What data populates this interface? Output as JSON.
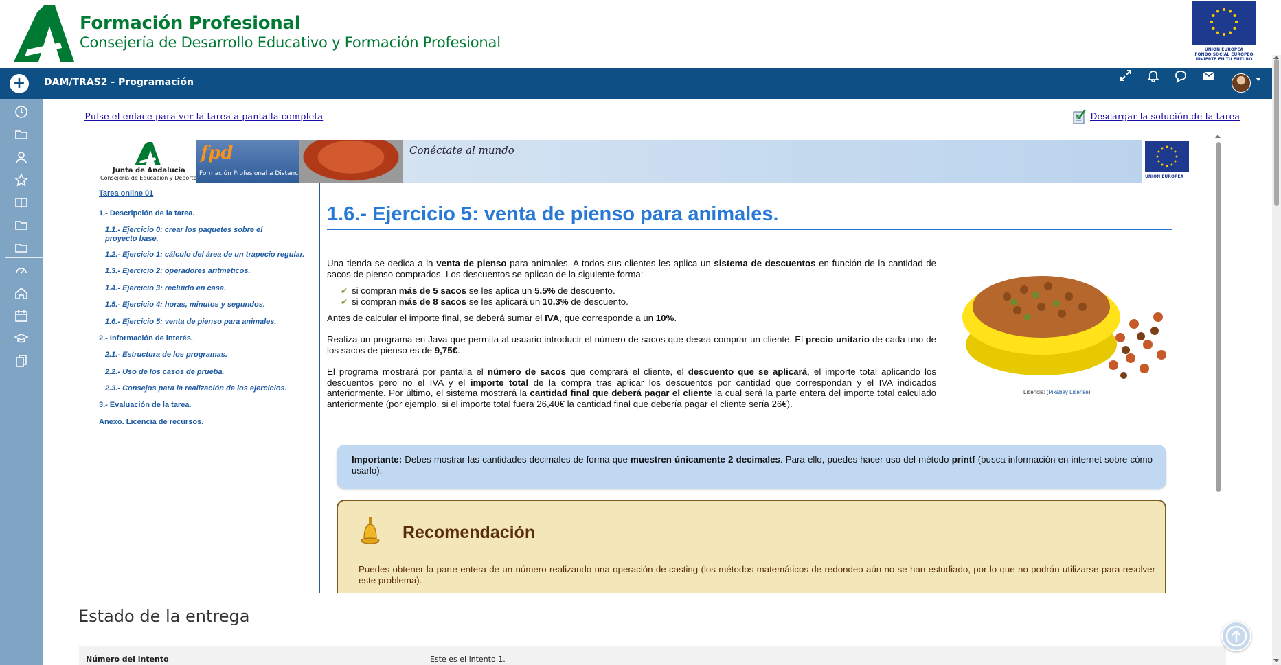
{
  "header": {
    "brand_title": "Formación Profesional",
    "brand_subtitle": "Consejería de Desarrollo Educativo y Formación Profesional",
    "eu_text_1": "UNIÓN EUROPEA",
    "eu_text_2": "FONDO SOCIAL EUROPEO",
    "eu_text_3": "INVIERTE EN TU FUTURO"
  },
  "navbar": {
    "title": "DAM/TRAS2 - Programación",
    "icons": [
      "fullscreen-icon",
      "bell-icon",
      "chat-icon",
      "mail-icon"
    ]
  },
  "sidebar": {
    "icons": [
      "clock-icon",
      "folder-icon",
      "users-icon",
      "star-icon",
      "book-icon",
      "folder-icon",
      "folder-icon",
      "dashboard-icon",
      "home-icon",
      "calendar-icon",
      "graduation-icon",
      "copy-icon"
    ]
  },
  "page": {
    "fullscreen_link": "Pulse el enlace para ver la tarea a pantalla completa",
    "solution_link": "Descargar la solución de la tarea"
  },
  "banner": {
    "junta_name": "Junta de Andalucía",
    "junta_dept": "Consejería de Educación y Deporte",
    "fpd_logo": "fpd",
    "fpd_text": "Formación Profesional a Distancia",
    "slogan": "Conéctate al mundo",
    "eu_label": "UNIÓN EUROPEA"
  },
  "toc": {
    "top": "Tarea online 01",
    "items": [
      {
        "label": "1.- Descripción de la tarea.",
        "level": 1
      },
      {
        "label": "1.1.- Ejercicio 0: crear los paquetes sobre el proyecto base.",
        "level": 2
      },
      {
        "label": "1.2.- Ejercicio 1: cálculo del área de un trapecio regular.",
        "level": 2
      },
      {
        "label": "1.3.- Ejercicio 2: operadores aritméticos.",
        "level": 2
      },
      {
        "label": "1.4.- Ejercicio 3: recluido en casa.",
        "level": 2
      },
      {
        "label": "1.5.- Ejercicio 4: horas, minutos y segundos.",
        "level": 2
      },
      {
        "label": "1.6.- Ejercicio 5: venta de pienso para animales.",
        "level": 2
      },
      {
        "label": "2.- Información de interés.",
        "level": 1
      },
      {
        "label": "2.1.- Estructura de los programas.",
        "level": 2
      },
      {
        "label": "2.2.- Uso de los casos de prueba.",
        "level": 2
      },
      {
        "label": "2.3.- Consejos para la realización de los ejercicios.",
        "level": 2
      },
      {
        "label": "3.- Evaluación de la tarea.",
        "level": 1
      },
      {
        "label": "Anexo. Licencia de recursos.",
        "level": 1
      }
    ]
  },
  "article": {
    "title": "1.6.- Ejercicio 5: venta de pienso para animales.",
    "p1_a": "Una tienda se dedica a la ",
    "p1_b": "venta de pienso",
    "p1_c": " para animales. A todos sus clientes les aplica un ",
    "p1_d": "sistema de descuentos",
    "p1_e": " en función de la cantidad de sacos de pienso comprados. Los descuentos se aplican de la siguiente forma:",
    "li1_a": "si compran ",
    "li1_b": "más de 5 sacos",
    "li1_c": " se les aplica un ",
    "li1_d": "5.5%",
    "li1_e": " de descuento.",
    "li2_a": "si compran ",
    "li2_b": "más de 8 sacos",
    "li2_c": " se les aplicará un ",
    "li2_d": "10.3%",
    "li2_e": " de descuento.",
    "p2_a": "Antes de calcular el importe final, se deberá sumar el ",
    "p2_b": "IVA",
    "p2_c": ", que corresponde a un ",
    "p2_d": "10%",
    "p2_e": ".",
    "p3_a": "Realiza un programa en Java que permita al usuario introducir el número de sacos que desea comprar un cliente. El ",
    "p3_b": "precio unitario",
    "p3_c": " de cada uno de los sacos de pienso es de ",
    "p3_d": "9,75€",
    "p3_e": ".",
    "p4_a": "El programa mostrará por pantalla el ",
    "p4_b": "número de sacos",
    "p4_c": " que comprará el cliente, el ",
    "p4_d": "descuento que se aplicará",
    "p4_e": ", el importe total aplicando los descuentos pero no el IVA y el ",
    "p4_f": "importe total",
    "p4_g": " de la compra tras aplicar los descuentos por cantidad que correspondan y el IVA indicados anteriormente. Por último, el sistema mostrará la ",
    "p4_h": "cantidad final que deberá pagar el cliente",
    "p4_i": " la cual será la parte entera del importe total calculado anteriormente (por ejemplo, si el importe total fuera 26,40€ la cantidad final que debería pagar el cliente sería 26€).",
    "caption_a": "Licencia: (",
    "caption_link": "Pixabay License",
    "caption_b": ")",
    "important_label": "Importante:",
    "important_a": " Debes mostrar las cantidades decimales de forma que ",
    "important_b": "muestren únicamente 2 decimales",
    "important_c": ". Para ello, puedes hacer uso del método ",
    "important_d": "printf",
    "important_e": " (busca información en internet sobre cómo usarlo).",
    "recom_title": "Recomendación",
    "recom_text": "Puedes obtener la parte entera de un número realizando una operación de casting (los métodos matemáticos de redondeo aún no se han estudiado, por lo que no podrán utilizarse para resolver este problema)."
  },
  "estado": {
    "title": "Estado de la entrega",
    "row_label": "Número del intento",
    "row_value": "Este es el intento 1."
  },
  "colors": {
    "brand_green": "#007a33",
    "navbar_blue": "#0e4f86",
    "sidebar_blue": "#7fa4c4",
    "title_blue": "#2779d5"
  }
}
